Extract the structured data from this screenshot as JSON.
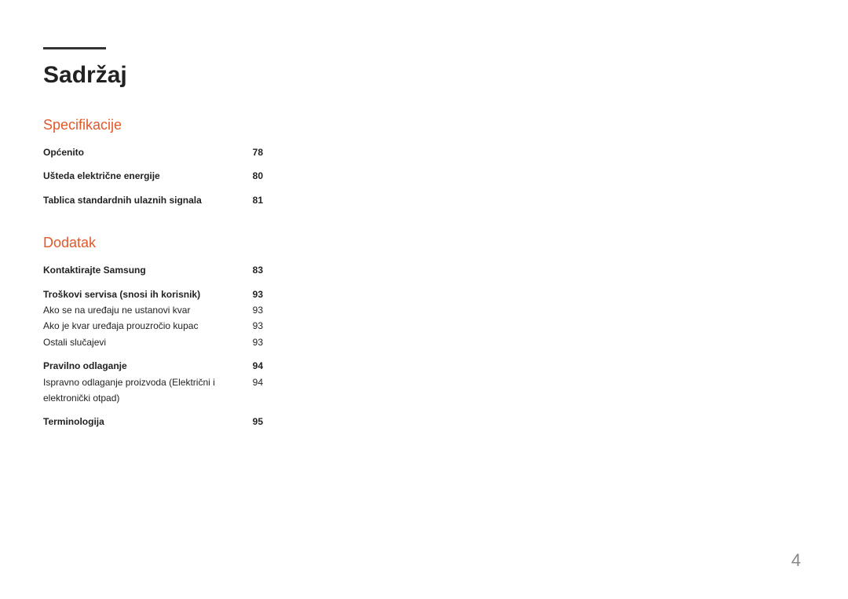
{
  "title": "Sadržaj",
  "pageNumber": "4",
  "sections": [
    {
      "heading": "Specifikacije",
      "rows": [
        {
          "label": "Općenito",
          "page": "78",
          "bold": true
        },
        {
          "gap": true
        },
        {
          "label": "Ušteda električne energije",
          "page": "80",
          "bold": true
        },
        {
          "gap": true
        },
        {
          "label": "Tablica standardnih ulaznih signala",
          "page": "81",
          "bold": true
        }
      ]
    },
    {
      "heading": "Dodatak",
      "rows": [
        {
          "label": "Kontaktirajte Samsung",
          "page": "83",
          "bold": true
        },
        {
          "gap": true
        },
        {
          "label": "Troškovi servisa (snosi ih korisnik)",
          "page": "93",
          "bold": true
        },
        {
          "label": "Ako se na uređaju ne ustanovi kvar",
          "page": "93",
          "bold": false
        },
        {
          "label": "Ako je kvar uređaja prouzročio kupac",
          "page": "93",
          "bold": false
        },
        {
          "label": "Ostali slučajevi",
          "page": "93",
          "bold": false
        },
        {
          "gap": true
        },
        {
          "label": "Pravilno odlaganje",
          "page": "94",
          "bold": true
        },
        {
          "label": "Ispravno odlaganje proizvoda (Električni i elektronički otpad)",
          "page": "94",
          "bold": false
        },
        {
          "gap": true
        },
        {
          "label": "Terminologija",
          "page": "95",
          "bold": true
        }
      ]
    }
  ]
}
